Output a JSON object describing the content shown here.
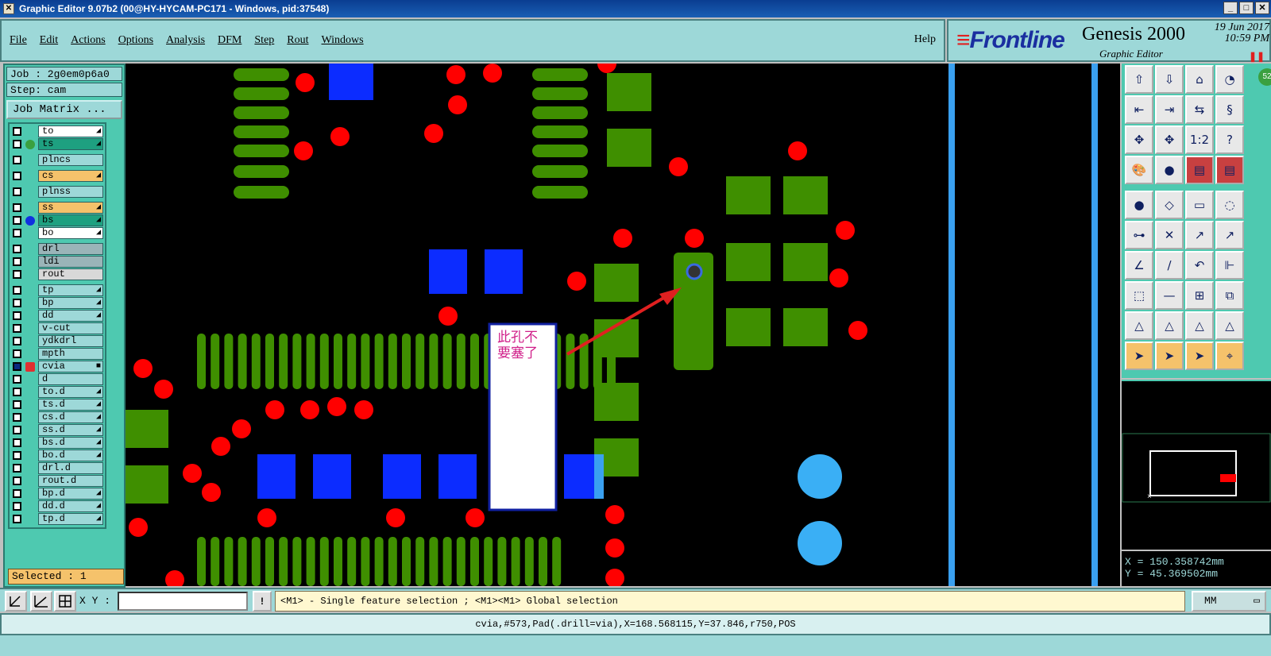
{
  "window": {
    "title": "Graphic Editor 9.07b2 (00@HY-HYCAM-PC171 - Windows, pid:37548)",
    "controls": [
      "_",
      "□",
      "✕"
    ]
  },
  "menu": {
    "items": [
      "File",
      "Edit",
      "Actions",
      "Options",
      "Analysis",
      "DFM",
      "Step",
      "Rout",
      "Windows"
    ],
    "help": "Help"
  },
  "brand": {
    "logo": "Frontline",
    "product": "Genesis 2000",
    "subtitle": "Graphic Editor",
    "date": "19 Jun 2017",
    "time": "10:59 PM",
    "badge": "52"
  },
  "job": {
    "job_label": "Job : 2g0em0p6a0",
    "step_label": "Step: cam",
    "matrix_button": "Job Matrix ..."
  },
  "layers": [
    {
      "name": "to",
      "style": "top",
      "dot": "",
      "arrow": true
    },
    {
      "name": "ts",
      "style": "sm",
      "dot": "#3aa040",
      "arrow": true
    },
    {
      "name": "plncs",
      "style": "",
      "dot": "",
      "arrow": false
    },
    {
      "name": "cs",
      "style": "cs",
      "dot": "",
      "arrow": true
    },
    {
      "name": "plnss",
      "style": "",
      "dot": "",
      "arrow": false
    },
    {
      "name": "ss",
      "style": "cs",
      "dot": "",
      "arrow": true
    },
    {
      "name": "bs",
      "style": "sm",
      "dot": "#1030e0",
      "arrow": true
    },
    {
      "name": "bo",
      "style": "top",
      "dot": "",
      "arrow": true
    },
    {
      "name": "drl",
      "style": "drl",
      "dot": "",
      "arrow": false
    },
    {
      "name": "ldi",
      "style": "drl",
      "dot": "",
      "arrow": false
    },
    {
      "name": "rout",
      "style": "rout",
      "dot": "",
      "arrow": false
    },
    {
      "name": "tp",
      "style": "",
      "dot": "",
      "arrow": true
    },
    {
      "name": "bp",
      "style": "",
      "dot": "",
      "arrow": true
    },
    {
      "name": "dd",
      "style": "",
      "dot": "",
      "arrow": true
    },
    {
      "name": "v-cut",
      "style": "",
      "dot": "",
      "arrow": false
    },
    {
      "name": "ydkdrl",
      "style": "",
      "dot": "",
      "arrow": false
    },
    {
      "name": "mpth",
      "style": "",
      "dot": "",
      "arrow": false
    },
    {
      "name": "cvia",
      "style": "",
      "dot": "",
      "arrow": true,
      "active": true
    },
    {
      "name": "d",
      "style": "",
      "dot": "",
      "arrow": false
    },
    {
      "name": "to.d",
      "style": "",
      "dot": "",
      "arrow": true
    },
    {
      "name": "ts.d",
      "style": "",
      "dot": "",
      "arrow": true
    },
    {
      "name": "cs.d",
      "style": "",
      "dot": "",
      "arrow": true
    },
    {
      "name": "ss.d",
      "style": "",
      "dot": "",
      "arrow": true
    },
    {
      "name": "bs.d",
      "style": "",
      "dot": "",
      "arrow": true
    },
    {
      "name": "bo.d",
      "style": "",
      "dot": "",
      "arrow": true
    },
    {
      "name": "drl.d",
      "style": "",
      "dot": "",
      "arrow": false
    },
    {
      "name": "rout.d",
      "style": "",
      "dot": "",
      "arrow": false
    },
    {
      "name": "bp.d",
      "style": "",
      "dot": "",
      "arrow": true
    },
    {
      "name": "dd.d",
      "style": "",
      "dot": "",
      "arrow": true
    },
    {
      "name": "tp.d",
      "style": "",
      "dot": "",
      "arrow": true
    }
  ],
  "selected_label": "Selected : 1",
  "annotation": {
    "line1": "此孔不",
    "line2": "要塞了"
  },
  "coords": {
    "x": "X = 150.358742mm",
    "y": "Y = 45.369502mm"
  },
  "command": {
    "xy_label": "X Y :",
    "xy_value": "",
    "hint": "<M1> - Single feature selection ; <M1><M1> Global selection",
    "units": "MM",
    "warn": "!"
  },
  "status": "cvia,#573,Pad(.drill=via),X=168.568115,Y=37.846,r750,POS",
  "colors": {
    "pad_green": "#3f8f00",
    "pad_blue": "#0c2cff",
    "via_red": "#ff0000",
    "panel_teal": "#4ec9b0",
    "menu_cyan": "#9dd8d8",
    "highlight": "#f5c26b"
  },
  "toolbar_icons": [
    "open-job-icon",
    "close-job-icon",
    "home-icon",
    "zoom-in-icon",
    "enter-step-icon",
    "exit-step-icon",
    "swap-icon",
    "snake-icon",
    "fit-icon",
    "center-icon",
    "scale-1to2-icon",
    "query-icon",
    "palette-icon",
    "measure-pad-icon",
    "layer-stack-icon",
    "layer-stack-2-icon",
    "pad-add-icon",
    "polygon-add-icon",
    "ruler-icon",
    "hole-icon",
    "connect-icon",
    "delete-icon",
    "move-point-icon",
    "move-point-2-icon",
    "line-red-icon",
    "line-blue-icon",
    "undo-arc-icon",
    "arc-ff-icon",
    "copy-icon",
    "minus-icon",
    "move-box-icon",
    "group-icon",
    "triangle-icon",
    "triangle-2-icon",
    "triangle-3-icon",
    "triangle-4-icon",
    "select-arrow-icon",
    "select-box-icon",
    "select-pointer-icon",
    "select-net-icon"
  ]
}
